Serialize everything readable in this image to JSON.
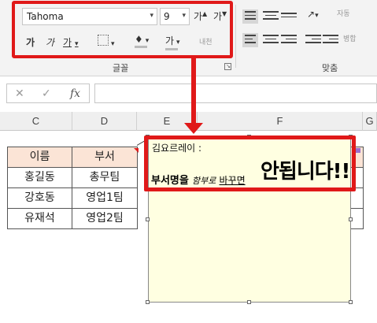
{
  "ribbon": {
    "font_name": "Tahoma",
    "font_size": "9",
    "grow_font_label": "가",
    "shrink_font_label": "가",
    "bold_label": "가",
    "italic_label": "가",
    "underline_label": "가",
    "font_color_label": "가",
    "phonetic_label": "내천",
    "font_group_label": "글꼴",
    "align_group_label": "맞춤",
    "wrap_label": "자동",
    "merge_label": "병합",
    "accent_color": "#e01919"
  },
  "formula_bar": {
    "fx_label": "fx",
    "value": ""
  },
  "columns": [
    "C",
    "D",
    "E",
    "F",
    "G"
  ],
  "table": {
    "headers": [
      "이름",
      "부서"
    ],
    "rows": [
      [
        "홍길동",
        "총무팀"
      ],
      [
        "강호동",
        "영업1팀"
      ],
      [
        "유재석",
        "영업2팀"
      ]
    ],
    "header_fill": "#fbe4d6"
  },
  "comment": {
    "author": "김요르레이 :",
    "text_bold": "부서명을",
    "text_italic": "함부로",
    "text_underline": "바꾸면",
    "text_big": "안됩니다!!",
    "background": "#ffffe1"
  }
}
